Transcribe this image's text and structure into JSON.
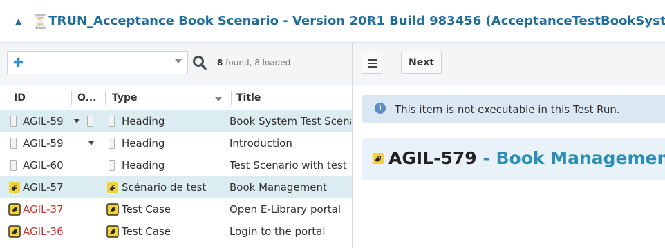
{
  "header": {
    "title": "TRUN_Acceptance Book Scenario - Version 20R1 Build 983456 (AcceptanceTestBookSystemScenario"
  },
  "search": {
    "placeholder": "",
    "found_count": "8",
    "found_suffix": " found, 8 loaded"
  },
  "columns": {
    "id": "ID",
    "o": "O...",
    "type": "Type",
    "title": "Title"
  },
  "rows": [
    {
      "id": "AGIL-59",
      "type": "Heading",
      "title": "Book System Test Scenario"
    },
    {
      "id": "AGIL-59",
      "type": "Heading",
      "title": "Introduction"
    },
    {
      "id": "AGIL-60",
      "type": "Heading",
      "title": "Test Scenario with test"
    },
    {
      "id": "AGIL-57",
      "type": "Scénario de test",
      "title": "Book Management"
    },
    {
      "id": "AGIL-37",
      "type": "Test Case",
      "title": "Open E-Library portal"
    },
    {
      "id": "AGIL-36",
      "type": "Test Case",
      "title": "Login to the portal"
    }
  ],
  "toolbar": {
    "next_label": "Next"
  },
  "detail": {
    "info_message": "This item is not executable in this Test Run.",
    "item_id": "AGIL-579",
    "item_dash": " - ",
    "item_name": "Book Management"
  },
  "colors": {
    "accent": "#1f6e9e",
    "selected_row": "#dcedf2",
    "info_bg": "#dbe8f3",
    "id_red": "#c0392b",
    "link_blue": "#2b8fb5"
  }
}
